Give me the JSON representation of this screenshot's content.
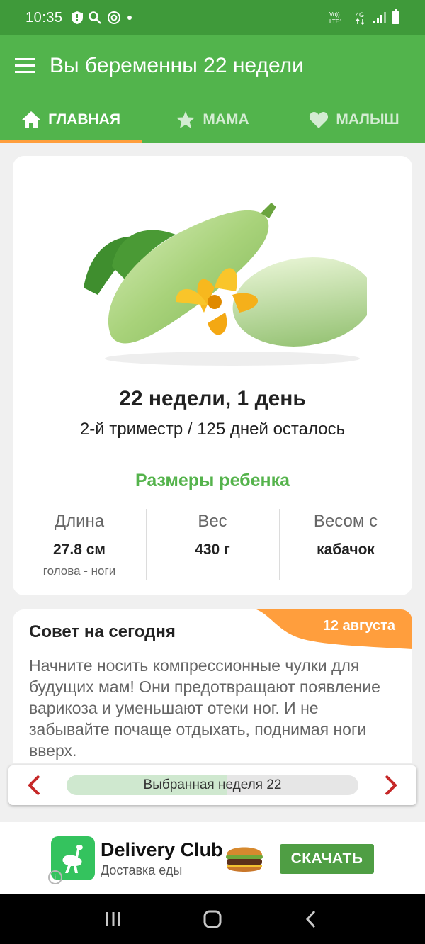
{
  "status_bar": {
    "time": "10:35",
    "network_label": "Vo)) 4G\nLTE1"
  },
  "app_bar": {
    "title": "Вы беременны 22 недели"
  },
  "tabs": [
    {
      "label": "ГЛАВНАЯ",
      "icon": "home-icon",
      "active": true
    },
    {
      "label": "МАМА",
      "icon": "star-icon",
      "active": false
    },
    {
      "label": "МАЛЫШ",
      "icon": "heart-icon",
      "active": false
    }
  ],
  "summary": {
    "image": "zucchini-image",
    "week_day": "22 недели, 1 день",
    "trimester": "2-й триместр / 125 дней осталось",
    "sizes_title": "Размеры ребенка",
    "stats": [
      {
        "label": "Длина",
        "value": "27.8 см",
        "sub": "голова - ноги"
      },
      {
        "label": "Вес",
        "value": "430 г",
        "sub": ""
      },
      {
        "label": "Весом с",
        "value": "кабачок",
        "sub": ""
      }
    ]
  },
  "tip": {
    "title": "Совет на сегодня",
    "date": "12 августа",
    "text": "Начните носить компрессионные чулки для будущих мам! Они предотвращают появление варикоза и уменьшают отеки ног. И не забывайте почаще отдыхать, поднимая ноги вверх."
  },
  "week_nav": {
    "label": "Выбранная неделя 22",
    "progress": 0.55
  },
  "ad": {
    "name": "Delivery Club",
    "subtitle": "Доставка еды",
    "button": "СКАЧАТЬ",
    "info": "i"
  },
  "colors": {
    "status_green": "#3f9a3a",
    "app_green": "#52b44c",
    "accent_orange": "#ff9e3d",
    "nav_red": "#c62828"
  }
}
